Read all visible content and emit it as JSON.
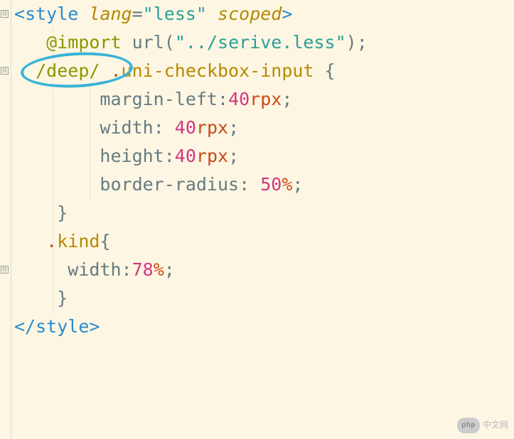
{
  "code": {
    "line1": {
      "tag_open": "<",
      "tag_name": "style",
      "attr1_name": "lang",
      "eq": "=",
      "attr1_val": "\"less\"",
      "attr2_name": "scoped",
      "tag_close": ">"
    },
    "line2": {
      "indent": "   ",
      "at": "@",
      "import": "import",
      "url_fn": "url",
      "paren_open": "(",
      "url_val": "\"../serive.less\"",
      "paren_close": ")",
      "semi": ";"
    },
    "line3": {
      "indent": "  ",
      "deep": "/deep/",
      "space": " ",
      "dot": ".",
      "class": "uni-checkbox-input",
      "space2": " ",
      "brace": "{"
    },
    "line4": {
      "indent": "        ",
      "prop": "margin-left",
      "colon": ":",
      "val": "40",
      "unit": "rpx",
      "semi": ";"
    },
    "line5": {
      "indent": "        ",
      "prop": "width",
      "colon": ": ",
      "val": "40",
      "unit": "rpx",
      "semi": ";"
    },
    "line6": {
      "indent": "        ",
      "prop": "height",
      "colon": ":",
      "val": "40",
      "unit": "rpx",
      "semi": ";"
    },
    "line7": {
      "indent": "        ",
      "prop": "border-radius",
      "colon": ": ",
      "val": "50",
      "unit": "%",
      "semi": ";"
    },
    "line8": {
      "indent": "    ",
      "brace": "}"
    },
    "line9": {
      "indent": "   ",
      "dot": ".",
      "class": "kind",
      "brace": "{"
    },
    "line10": {
      "indent": "     ",
      "prop": "width",
      "colon": ":",
      "val": "78",
      "unit": "%",
      "semi": ";"
    },
    "line11": {
      "indent": "    ",
      "brace": "}"
    },
    "line12": {
      "tag_open": "</",
      "tag_name": "style",
      "tag_close": ">"
    }
  },
  "fold_symbol": "⊟",
  "watermark": {
    "badge": "php",
    "text": "中文网"
  },
  "annotation": {
    "circled_text": "/deep/"
  }
}
